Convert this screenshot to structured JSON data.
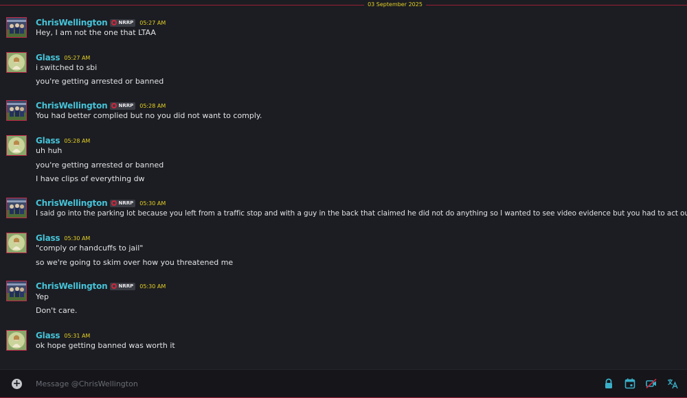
{
  "date_divider": "03 September 2025",
  "colors": {
    "accent": "#c4284a",
    "username": "#46c3d8",
    "timestamp": "#e4d026",
    "text": "#e2e3e6"
  },
  "messages": [
    {
      "author": "ChrisWellington",
      "badge": "NRRP",
      "time": "05:27 AM",
      "lines": [
        "Hey, I am not the one that LTAA"
      ]
    },
    {
      "author": "Glass",
      "time": "05:27 AM",
      "lines": [
        "i switched to sbi",
        "you're getting arrested or banned"
      ]
    },
    {
      "author": "ChrisWellington",
      "badge": "NRRP",
      "time": "05:28 AM",
      "lines": [
        "You had better complied but no you did not want to comply."
      ]
    },
    {
      "author": "Glass",
      "time": "05:28 AM",
      "lines": [
        "uh huh",
        "you're getting arrested or banned",
        "I have clips of everything dw"
      ]
    },
    {
      "author": "ChrisWellington",
      "badge": "NRRP",
      "time": "05:30 AM",
      "lines": [
        "I said go into the parking lot because you left from a traffic stop and with a guy in the back that claimed he did not do anything so I wanted to see video evidence but you had to act out."
      ]
    },
    {
      "author": "Glass",
      "time": "05:30 AM",
      "lines": [
        "\"comply or handcuffs to jail\"",
        "so we're going to skim over how you threatened me"
      ]
    },
    {
      "author": "ChrisWellington",
      "badge": "NRRP",
      "time": "05:30 AM",
      "lines": [
        "Yep",
        "Don't care."
      ]
    },
    {
      "author": "Glass",
      "time": "05:31 AM",
      "lines": [
        "ok hope getting banned was worth it"
      ]
    }
  ],
  "composer": {
    "placeholder": "Message @ChrisWellington",
    "icons": [
      "plus-circle-icon",
      "lock-icon",
      "calendar-icon",
      "no-video-icon",
      "translate-icon"
    ]
  }
}
